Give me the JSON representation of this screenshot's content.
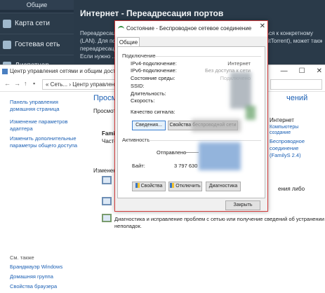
{
  "router": {
    "sidebar_top": "Общие",
    "sidebar_items": [
      "Карта сети",
      "Гостевая сеть",
      "Диспетчер"
    ],
    "title": "Интернет - Переадресация портов",
    "text_lines": [
      "Переадресация портов позволяет удаленным компьютерам подключаться к конкретному",
      "(LAN). Для получения быстрого подключения приложений (например, BitTorrent), может также",
      "переадресации портов в данном случае, для программ P2P",
      "Если нужно ... ..."
    ]
  },
  "control_panel": {
    "window_title": "Центр управления сетями и общим доступом",
    "address_text": "« Сеть... › Центр управления",
    "left_links": [
      "Панель управления\nдомашняя страница",
      "Изменение параметров\nадаптера",
      "Изменить дополнительные\nпараметры общего доступа"
    ],
    "heading": "Просмо",
    "heading_right": "чений",
    "subheading": "Просмотр",
    "network_name": "Family",
    "network_type": "Часто",
    "right_access": "Интернет",
    "right_link": "Беспроводное\nсоединение\n(FamilyS 2.4)",
    "right_link_top": "Компьютеры\nсоздание",
    "change_label": "Изменен",
    "change_right": "ения либо",
    "diag_text": "Диагностика и исправление проблем с сетью или получение сведений об устранении\nнеполадок.",
    "see_also_head": "См. также",
    "see_also": [
      "Брандмауэр Windows",
      "Домашняя группа",
      "Свойства браузера"
    ]
  },
  "dialog": {
    "title": "Состояние - Беспроводное сетевое соединение",
    "close": "✕",
    "tab": "Общие",
    "connection_group": "Подключение",
    "rows": [
      {
        "k": "IPv4-подключение:",
        "v": "Интернет"
      },
      {
        "k": "IPv6-подключение:",
        "v": "Без доступа к сети"
      },
      {
        "k": "Состояние среды:",
        "v": "Подключено"
      },
      {
        "k": "SSID:",
        "v": ""
      },
      {
        "k": "Длительность:",
        "v": ""
      },
      {
        "k": "Скорость:",
        "v": ""
      }
    ],
    "signal_label": "Качество сигнала:",
    "btn_details": "Сведения...",
    "btn_wireless": "Свойства беспроводной сети",
    "activity_group": "Активность",
    "sent_label": "Отправлено",
    "bytes_label": "Байт:",
    "bytes_sent": "3 797 630",
    "btn_properties": "Свойства",
    "btn_disable": "Отключить",
    "btn_diagnose": "Диагностика",
    "btn_close": "Закрыть"
  }
}
